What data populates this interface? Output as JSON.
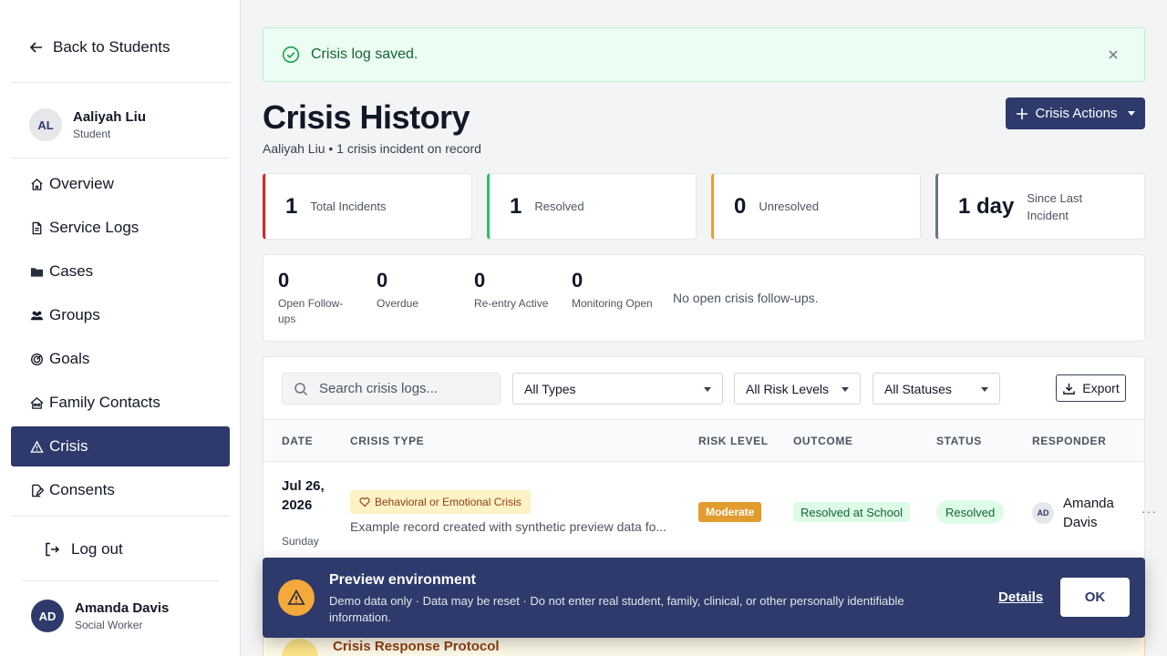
{
  "sidebar": {
    "back_label": "Back to Students",
    "student": {
      "initials": "AL",
      "name": "Aaliyah Liu",
      "role": "Student"
    },
    "nav": [
      {
        "label": "Overview",
        "icon": "home-icon"
      },
      {
        "label": "Service Logs",
        "icon": "file-icon"
      },
      {
        "label": "Cases",
        "icon": "folder-icon"
      },
      {
        "label": "Groups",
        "icon": "users-icon"
      },
      {
        "label": "Goals",
        "icon": "target-icon"
      },
      {
        "label": "Family Contacts",
        "icon": "family-icon"
      },
      {
        "label": "Crisis",
        "icon": "warning-icon",
        "active": true
      },
      {
        "label": "Consents",
        "icon": "edit-document-icon"
      }
    ],
    "logout_label": "Log out",
    "user": {
      "initials": "AD",
      "name": "Amanda Davis",
      "role": "Social Worker"
    }
  },
  "toast": {
    "message": "Crisis log saved."
  },
  "header": {
    "title": "Crisis History",
    "subtitle": "Aaliyah Liu • 1 crisis incident on record",
    "actions_label": "Crisis Actions"
  },
  "stats": [
    {
      "value": "1",
      "label": "Total Incidents",
      "color": "#dc2626"
    },
    {
      "value": "1",
      "label": "Resolved",
      "color": "#22c55e"
    },
    {
      "value": "0",
      "label": "Unresolved",
      "color": "#f59e0b"
    },
    {
      "value": "1 day",
      "label": "Since Last Incident",
      "color": "#6b7280"
    }
  ],
  "metrics": {
    "items": [
      {
        "value": "0",
        "label": "Open Follow-ups"
      },
      {
        "value": "0",
        "label": "Overdue"
      },
      {
        "value": "0",
        "label": "Re-entry Active"
      },
      {
        "value": "0",
        "label": "Monitoring Open"
      }
    ],
    "note": "No open crisis follow-ups."
  },
  "filters": {
    "search_placeholder": "Search crisis logs...",
    "type": "All Types",
    "risk": "All Risk Levels",
    "status": "All Statuses",
    "export_label": "Export"
  },
  "table": {
    "columns": [
      "DATE",
      "CRISIS TYPE",
      "RISK LEVEL",
      "OUTCOME",
      "STATUS",
      "RESPONDER"
    ],
    "rows": [
      {
        "date": "Jul 26, 2026",
        "day": "Sunday",
        "type": "Behavioral or Emotional Crisis",
        "description": "Example record created with synthetic preview data fo...",
        "risk": "Moderate",
        "outcome": "Resolved at School",
        "status": "Resolved",
        "responder_initials": "AD",
        "responder": "Amanda Davis"
      }
    ],
    "more_label": "···"
  },
  "protocol": {
    "title": "Crisis Response Protocol"
  },
  "banner": {
    "title": "Preview environment",
    "text": "Demo data only · Data may be reset · Do not enter real student, family, clinical, or other personally identifiable information.",
    "details_label": "Details",
    "ok_label": "OK"
  },
  "colors": {
    "primary": "#2d3a6b",
    "accent": "#f4a93b",
    "success": "#166534"
  }
}
